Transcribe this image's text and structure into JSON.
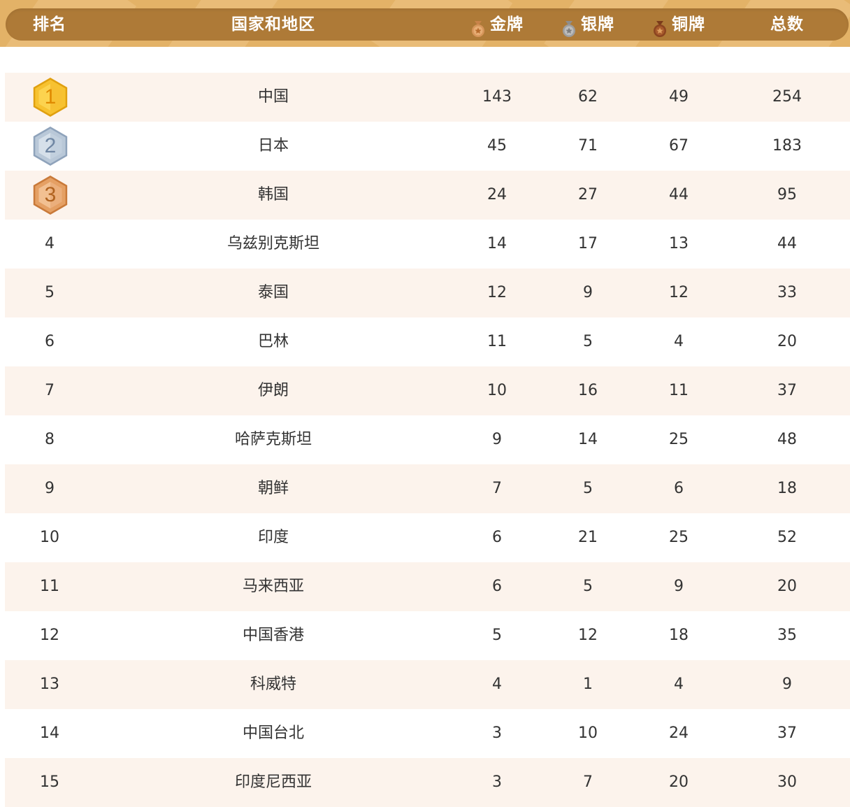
{
  "header": {
    "rank": "排名",
    "country": "国家和地区",
    "gold": "金牌",
    "silver": "银牌",
    "bronze": "铜牌",
    "total": "总数",
    "gold_icon": "gold-medal-icon",
    "silver_icon": "silver-medal-icon",
    "bronze_icon": "bronze-medal-icon"
  },
  "colors": {
    "header_band": "#e3b267",
    "header_pill": "#ae7a37",
    "row_tint": "#fcf3ec",
    "gold": "#f7b91c",
    "silver": "#a9b9cc",
    "bronze": "#d9853e"
  },
  "rows": [
    {
      "rank": "1",
      "country": "中国",
      "gold": "143",
      "silver": "62",
      "bronze": "49",
      "total": "254"
    },
    {
      "rank": "2",
      "country": "日本",
      "gold": "45",
      "silver": "71",
      "bronze": "67",
      "total": "183"
    },
    {
      "rank": "3",
      "country": "韩国",
      "gold": "24",
      "silver": "27",
      "bronze": "44",
      "total": "95"
    },
    {
      "rank": "4",
      "country": "乌兹别克斯坦",
      "gold": "14",
      "silver": "17",
      "bronze": "13",
      "total": "44"
    },
    {
      "rank": "5",
      "country": "泰国",
      "gold": "12",
      "silver": "9",
      "bronze": "12",
      "total": "33"
    },
    {
      "rank": "6",
      "country": "巴林",
      "gold": "11",
      "silver": "5",
      "bronze": "4",
      "total": "20"
    },
    {
      "rank": "7",
      "country": "伊朗",
      "gold": "10",
      "silver": "16",
      "bronze": "11",
      "total": "37"
    },
    {
      "rank": "8",
      "country": "哈萨克斯坦",
      "gold": "9",
      "silver": "14",
      "bronze": "25",
      "total": "48"
    },
    {
      "rank": "9",
      "country": "朝鲜",
      "gold": "7",
      "silver": "5",
      "bronze": "6",
      "total": "18"
    },
    {
      "rank": "10",
      "country": "印度",
      "gold": "6",
      "silver": "21",
      "bronze": "25",
      "total": "52"
    },
    {
      "rank": "11",
      "country": "马来西亚",
      "gold": "6",
      "silver": "5",
      "bronze": "9",
      "total": "20"
    },
    {
      "rank": "12",
      "country": "中国香港",
      "gold": "5",
      "silver": "12",
      "bronze": "18",
      "total": "35"
    },
    {
      "rank": "13",
      "country": "科威特",
      "gold": "4",
      "silver": "1",
      "bronze": "4",
      "total": "9"
    },
    {
      "rank": "14",
      "country": "中国台北",
      "gold": "3",
      "silver": "10",
      "bronze": "24",
      "total": "37"
    },
    {
      "rank": "15",
      "country": "印度尼西亚",
      "gold": "3",
      "silver": "7",
      "bronze": "20",
      "total": "30"
    }
  ]
}
